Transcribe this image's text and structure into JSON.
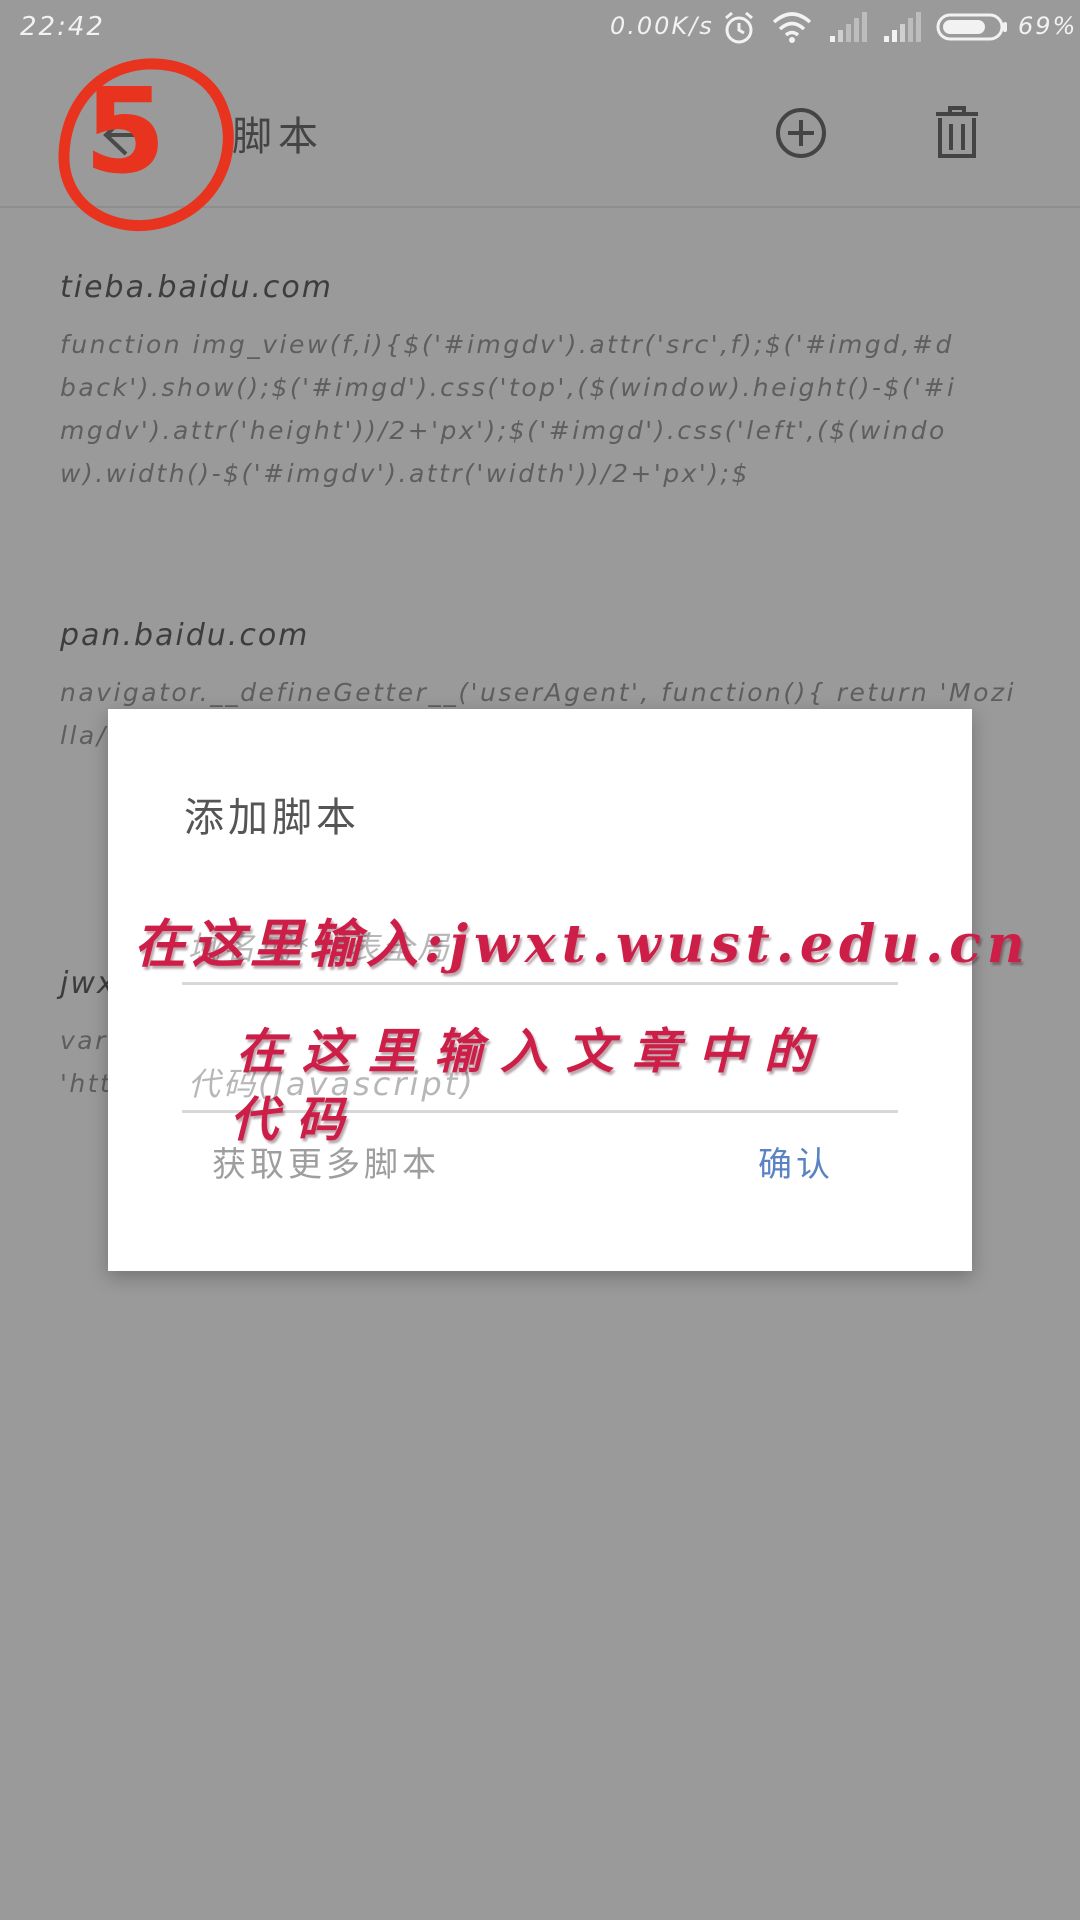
{
  "status_bar": {
    "time": "22:42",
    "network_speed": "0.00K/s",
    "battery_percent": "69%",
    "icons": [
      "alarm-icon",
      "wifi-icon",
      "signal-icon",
      "signal-icon",
      "battery-icon"
    ]
  },
  "toolbar": {
    "title": "脚本",
    "back_icon": "arrow-left-icon",
    "add_icon": "plus-circle-icon",
    "delete_icon": "trash-icon"
  },
  "scripts": [
    {
      "domain": "tieba.baidu.com",
      "code": "function img_view(f,i){$('#imgdv').attr('src',f);$('#imgd,#dback').show();$('#imgd').css('top',($(window).height()-$('#imgdv').attr('height'))/2+'px');$('#imgd').css('left',($(window).width()-$('#imgdv').attr('width'))/2+'px');$"
    },
    {
      "domain": "pan.baidu.com",
      "code": "navigator.__defineGetter__('userAgent', function(){ return 'Mozilla/5.0 (Sy Con Nok"
    },
    {
      "domain": "jwx",
      "code": "var 'htt"
    }
  ],
  "dialog": {
    "title": "添加脚本",
    "domain_placeholder": "域名或*代表全局",
    "code_placeholder": "代码(Javascript)",
    "more_scripts_label": "获取更多脚本",
    "confirm_label": "确认"
  },
  "annotations": {
    "step_number": "5",
    "domain_hint": "在这里输入:jwxt.wust.edu.cn",
    "code_hint_line1": "在这里输入文章中的",
    "code_hint_line2": "代码"
  },
  "colors": {
    "overlay_background": "#9a9a9a",
    "dialog_background": "#ffffff",
    "confirm_accent": "#5b83c4",
    "annotation_red": "#cc1e47",
    "step_circle_red": "#e8341f"
  }
}
